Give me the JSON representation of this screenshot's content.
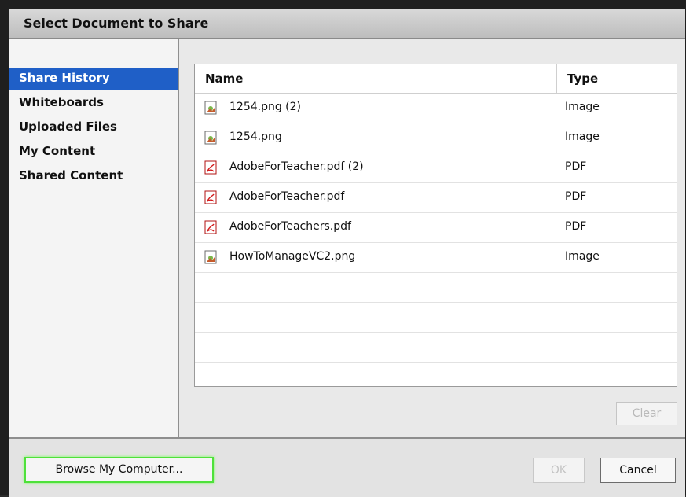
{
  "window": {
    "title": "Select Document to Share"
  },
  "sidebar": {
    "items": [
      {
        "label": "Share History",
        "selected": true
      },
      {
        "label": "Whiteboards",
        "selected": false
      },
      {
        "label": "Uploaded Files",
        "selected": false
      },
      {
        "label": "My Content",
        "selected": false
      },
      {
        "label": "Shared Content",
        "selected": false
      }
    ]
  },
  "table": {
    "columns": {
      "name": "Name",
      "type": "Type"
    },
    "rows": [
      {
        "name": "1254.png (2)",
        "type": "Image",
        "icon": "image-file-icon"
      },
      {
        "name": "1254.png",
        "type": "Image",
        "icon": "image-file-icon"
      },
      {
        "name": "AdobeForTeacher.pdf (2)",
        "type": "PDF",
        "icon": "pdf-file-icon"
      },
      {
        "name": "AdobeForTeacher.pdf",
        "type": "PDF",
        "icon": "pdf-file-icon"
      },
      {
        "name": "AdobeForTeachers.pdf",
        "type": "PDF",
        "icon": "pdf-file-icon"
      },
      {
        "name": "HowToManageVC2.png",
        "type": "Image",
        "icon": "image-file-icon"
      }
    ]
  },
  "buttons": {
    "clear": "Clear",
    "browse": "Browse My Computer...",
    "ok": "OK",
    "cancel": "Cancel"
  },
  "colors": {
    "selection": "#1f5fc7",
    "browse_highlight": "#4ee13a"
  }
}
